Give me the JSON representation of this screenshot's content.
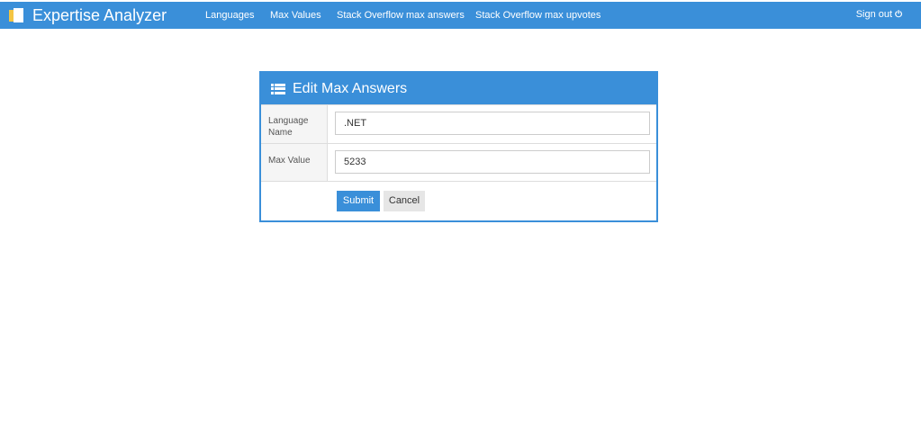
{
  "brand": {
    "name": "Expertise Analyzer",
    "logo_icon": "book-icon"
  },
  "nav": {
    "links": [
      "Languages",
      "Max Values",
      "Stack Overflow max answers",
      "Stack Overflow max upvotes"
    ],
    "signout": "Sign out",
    "signout_icon": "power-icon"
  },
  "panel": {
    "title": "Edit Max Answers",
    "title_icon": "list-icon",
    "fields": [
      {
        "label": "Language Name",
        "value": ".NET"
      },
      {
        "label": "Max Value",
        "value": "5233"
      }
    ],
    "submit": "Submit",
    "cancel": "Cancel"
  },
  "colors": {
    "primary": "#3a8fd9",
    "label_bg": "#f5f5f5",
    "cancel_bg": "#e6e6e6"
  }
}
